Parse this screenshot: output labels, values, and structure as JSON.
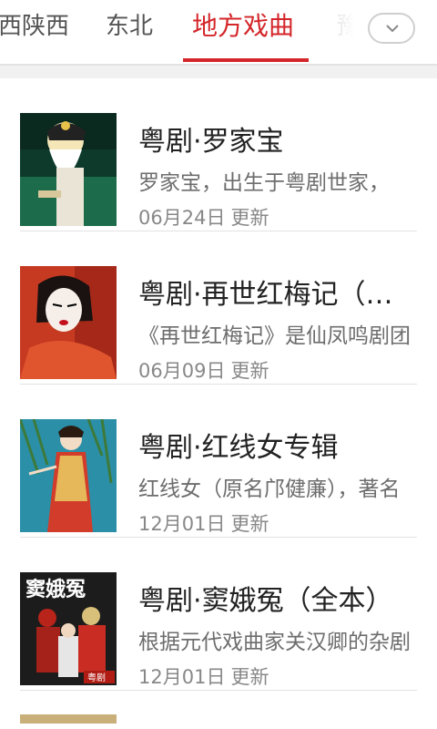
{
  "tabs": [
    {
      "label": "西陕西",
      "active": false
    },
    {
      "label": "东北",
      "active": false
    },
    {
      "label": "地方戏曲",
      "active": true
    },
    {
      "label": "豫",
      "active": false
    }
  ],
  "expand_icon": "chevron-down-icon",
  "accent_color": "#d4262a",
  "update_suffix": "更新",
  "items": [
    {
      "title": "粤剧·罗家宝",
      "desc": "罗家宝，出生于粤剧世家，",
      "date": "06月24日"
    },
    {
      "title": "粤剧·再世红梅记（全本）",
      "desc": "《再世红梅记》是仙凤鸣剧团",
      "date": "06月09日"
    },
    {
      "title": "粤剧·红线女专辑",
      "desc": "红线女（原名邝健廉），著名",
      "date": "12月01日"
    },
    {
      "title": "粤剧·窦娥冤（全本）",
      "desc": "根据元代戏曲家关汉卿的杂剧",
      "date": "12月01日"
    }
  ],
  "thumb_texts": {
    "poster_title": "窦娥冤",
    "poster_tag": "粤剧"
  }
}
